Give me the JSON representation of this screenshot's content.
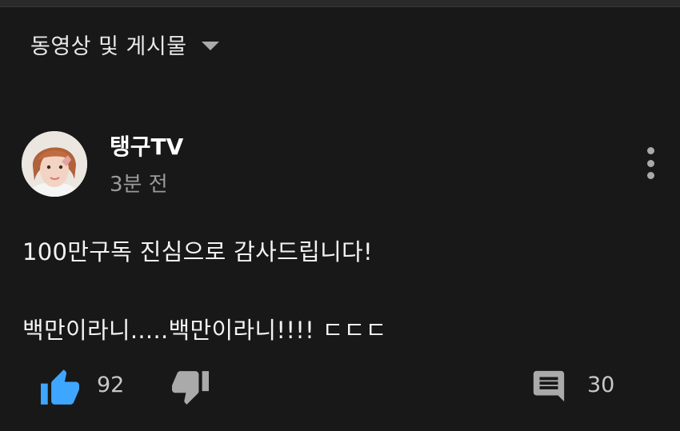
{
  "filter": {
    "label": "동영상 및 게시물"
  },
  "post": {
    "author": "탱구TV",
    "time": "3분 전",
    "text_line1": "100만구독 진심으로 감사드립니다!",
    "text_line2": "백만이라니.....백만이라니!!!! ㄷㄷㄷ",
    "likes": "92",
    "comments": "30"
  },
  "colors": {
    "background": "#181818",
    "like_active": "#3ea6ff",
    "icon_gray": "#aaaaaa"
  }
}
